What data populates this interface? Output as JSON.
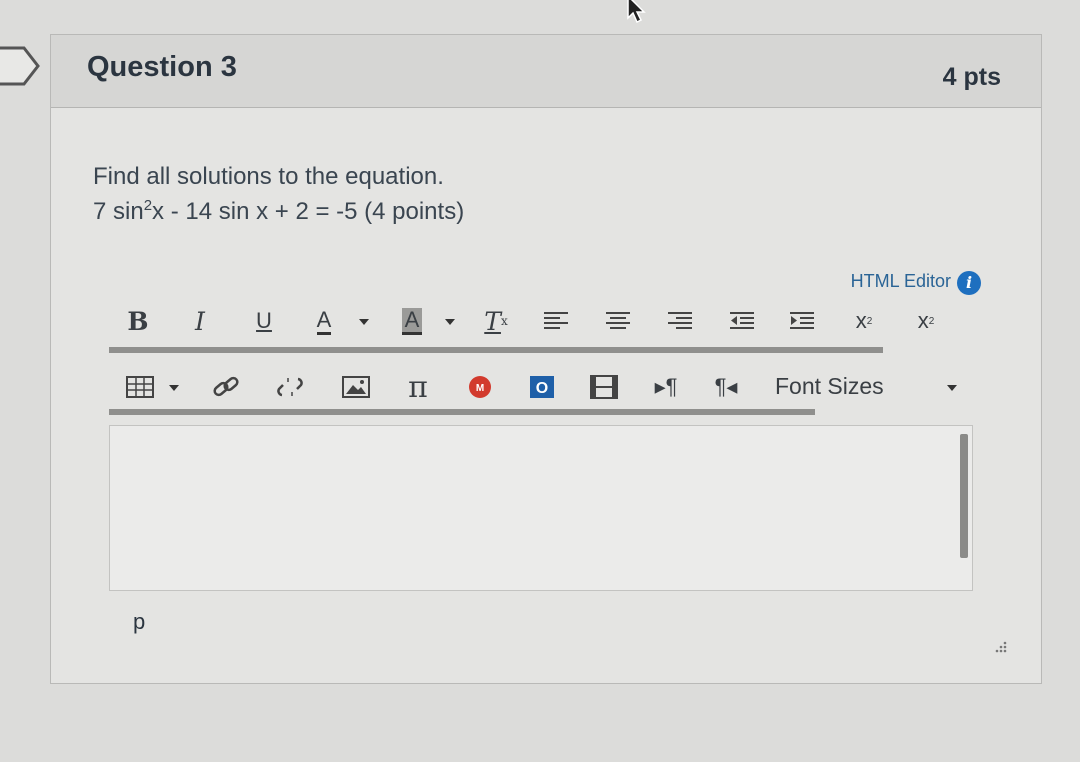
{
  "question": {
    "title": "Question 3",
    "points": "4 pts",
    "prompt_line1": "Find all solutions to the equation.",
    "prompt_eq_a": "7 sin",
    "prompt_eq_sup": "2",
    "prompt_eq_b": "x - 14 sin x + 2 = -5 (4 points)"
  },
  "editor": {
    "html_editor_label": "HTML Editor",
    "info_icon_glyph": "i",
    "font_sizes_label": "Font Sizes",
    "path_label": "p",
    "content": ""
  },
  "toolbar_row1": [
    "bold-icon",
    "italic-icon",
    "underline-icon",
    "text-color-icon",
    "background-color-icon",
    "clear-formatting-icon",
    "align-left-icon",
    "align-center-icon",
    "align-right-icon",
    "outdent-icon",
    "indent-icon",
    "superscript-icon",
    "subscript-icon"
  ],
  "toolbar_row2": [
    "table-icon",
    "link-icon",
    "unlink-icon",
    "image-icon",
    "math-equation-icon",
    "media-icon",
    "office365-icon",
    "embed-media-icon",
    "ltr-icon",
    "rtl-icon"
  ],
  "colors": {
    "accent": "#1e6fbf",
    "text": "#2d3b45"
  }
}
